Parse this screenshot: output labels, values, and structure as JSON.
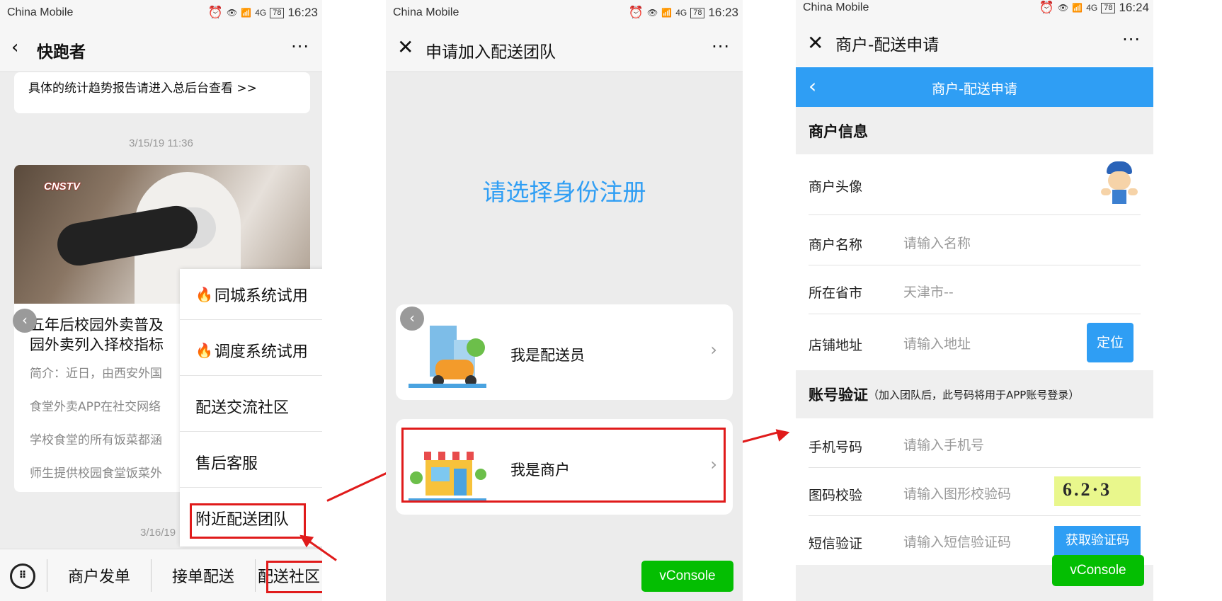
{
  "status": {
    "carrier": "China Mobile",
    "signal": "4G",
    "battery": "78",
    "time1": "16:23",
    "time2": "16:23",
    "time3": "16:24"
  },
  "phone1": {
    "title": "快跑者",
    "top_card_text": "具体的统计趋势报告请进入总后台查看 >>",
    "timestamp": "3/15/19 11:36",
    "timestamp2": "3/16/19",
    "video_logo": "CNSTV",
    "article_title": "五年后校园外卖普及 园外卖列入择校指标",
    "article_lines": [
      "简介：近日，由西安外国",
      "食堂外卖APP在社交网络",
      "学校食堂的所有饭菜都涵",
      "师生提供校园食堂饭菜外"
    ],
    "popup": [
      "同城系统试用",
      "调度系统试用",
      "配送交流社区",
      "售后客服",
      "附近配送团队"
    ],
    "tabs": [
      "商户发单",
      "接单配送",
      "配送社区"
    ]
  },
  "phone2": {
    "title": "申请加入配送团队",
    "heading": "请选择身份注册",
    "option_courier": "我是配送员",
    "option_merchant": "我是商户",
    "vconsole": "vConsole"
  },
  "phone3": {
    "title": "商户-配送申请",
    "header_title": "商户-配送申请",
    "section1": "商户信息",
    "avatar_label": "商户头像",
    "name_label": "商户名称",
    "name_ph": "请输入名称",
    "city_label": "所在省市",
    "city_value": "天津市--",
    "address_label": "店铺地址",
    "address_ph": "请输入地址",
    "locate_btn": "定位",
    "section2": "账号验证",
    "section2_note": "（加入团队后，此号码将用于APP账号登录）",
    "phone_label": "手机号码",
    "phone_ph": "请输入手机号",
    "captcha_label": "图码校验",
    "captcha_ph": "请输入图形校验码",
    "captcha_text": "6.2·3",
    "sms_label": "短信验证",
    "sms_ph": "请输入短信验证码",
    "sms_btn": "获取验证码",
    "vconsole": "vConsole"
  },
  "colors": {
    "accent_blue": "#2f9ef4",
    "red_annotation": "#e01b1b",
    "vconsole_green": "#04be02"
  }
}
